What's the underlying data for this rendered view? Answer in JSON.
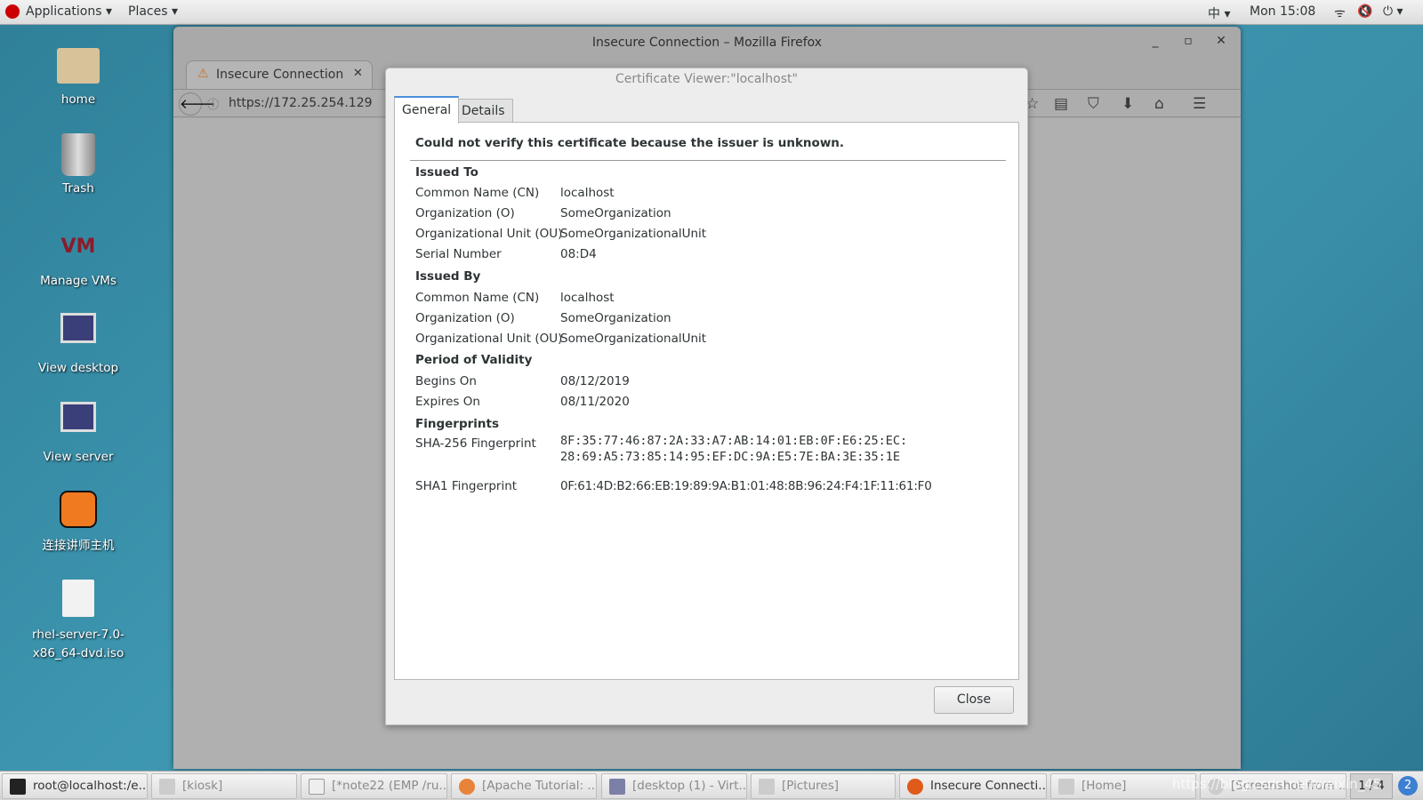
{
  "topbar": {
    "applications": "Applications",
    "places": "Places",
    "input_method": "中",
    "clock": "Mon 15:08"
  },
  "desktop": {
    "icons": [
      {
        "label": "home"
      },
      {
        "label": "Trash"
      },
      {
        "label": "Manage VMs"
      },
      {
        "label": "View desktop"
      },
      {
        "label": "View server"
      },
      {
        "label": "连接讲师主机"
      },
      {
        "label": "rhel-server-7.0-x86_64-dvd.iso"
      }
    ]
  },
  "firefox": {
    "title": "Insecure Connection – Mozilla Firefox",
    "tab_label": "Insecure Connection",
    "url": "https://172.25.254.129"
  },
  "dialog": {
    "title": "Certificate Viewer:\"localhost\"",
    "tabs": [
      {
        "label": "General"
      },
      {
        "label": "Details"
      }
    ],
    "message": "Could not verify this certificate because the issuer is unknown.",
    "issued_to": {
      "heading": "Issued To",
      "rows": [
        {
          "label": "Common Name (CN)",
          "value": "localhost"
        },
        {
          "label": "Organization (O)",
          "value": "SomeOrganization"
        },
        {
          "label": "Organizational Unit (OU)",
          "value": "SomeOrganizationalUnit"
        },
        {
          "label": "Serial Number",
          "value": "08:D4"
        }
      ]
    },
    "issued_by": {
      "heading": "Issued By",
      "rows": [
        {
          "label": "Common Name (CN)",
          "value": "localhost"
        },
        {
          "label": "Organization (O)",
          "value": "SomeOrganization"
        },
        {
          "label": "Organizational Unit (OU)",
          "value": "SomeOrganizationalUnit"
        }
      ]
    },
    "validity": {
      "heading": "Period of Validity",
      "rows": [
        {
          "label": "Begins On",
          "value": "08/12/2019"
        },
        {
          "label": "Expires On",
          "value": "08/11/2020"
        }
      ]
    },
    "fingerprints": {
      "heading": "Fingerprints",
      "sha256_label": "SHA-256 Fingerprint",
      "sha256_line1": "8F:35:77:46:87:2A:33:A7:AB:14:01:EB:0F:E6:25:EC:",
      "sha256_line2": "28:69:A5:73:85:14:95:EF:DC:9A:E5:7E:BA:3E:35:1E",
      "sha1_label": "SHA1 Fingerprint",
      "sha1_value": "0F:61:4D:B2:66:EB:19:89:9A:B1:01:48:8B:96:24:F4:1F:11:61:F0"
    },
    "close_label": "Close"
  },
  "taskbar": {
    "items": [
      {
        "label": "root@localhost:/e..."
      },
      {
        "label": "[kiosk]"
      },
      {
        "label": "[*note22 (EMP /ru..."
      },
      {
        "label": "[Apache Tutorial: ..."
      },
      {
        "label": "[desktop (1) - Virt..."
      },
      {
        "label": "[Pictures]"
      },
      {
        "label": "Insecure Connecti..."
      },
      {
        "label": "[Home]"
      },
      {
        "label": "[Screenshot from ..."
      }
    ],
    "pager": "1 / 4",
    "badge": "2",
    "watermark": "https://blog.csdn.net/weixin_45"
  }
}
